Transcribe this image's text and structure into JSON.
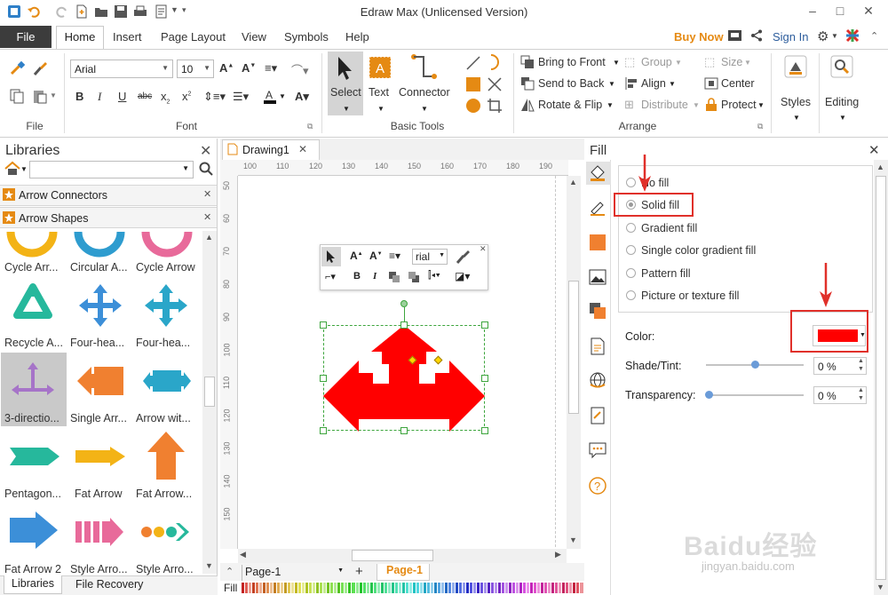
{
  "window": {
    "title": "Edraw Max (Unlicensed Version)",
    "minimize": "–",
    "maximize": "□",
    "close": "✕"
  },
  "menu": {
    "file": "File",
    "home": "Home",
    "insert": "Insert",
    "page_layout": "Page Layout",
    "view": "View",
    "symbols": "Symbols",
    "help": "Help",
    "buy_now": "Buy Now",
    "sign_in": "Sign In"
  },
  "ribbon": {
    "font_name": "Arial",
    "font_size": "10",
    "groups": {
      "file": "File",
      "font": "Font",
      "basic_tools": "Basic Tools",
      "arrange": "Arrange"
    },
    "tools": {
      "select": "Select",
      "text": "Text",
      "connector": "Connector"
    },
    "arrange": {
      "bring_front": "Bring to Front",
      "send_back": "Send to Back",
      "rotate_flip": "Rotate & Flip",
      "group": "Group",
      "align": "Align",
      "distribute": "Distribute",
      "size": "Size",
      "center": "Center",
      "protect": "Protect"
    },
    "styles": "Styles",
    "editing": "Editing"
  },
  "libraries": {
    "title": "Libraries",
    "search_placeholder": "",
    "sections": [
      "Arrow Connectors",
      "Arrow Shapes"
    ],
    "shapes": [
      [
        "Cycle Arr...",
        "Circular A...",
        "Cycle Arrow"
      ],
      [
        "Recycle A...",
        "Four-hea...",
        "Four-hea..."
      ],
      [
        "3-directio...",
        "Single Arr...",
        "Arrow wit..."
      ],
      [
        "Pentagon...",
        "Fat Arrow",
        "Fat Arrow..."
      ],
      [
        "Fat Arrow 2",
        "Style Arro...",
        "Style Arro..."
      ]
    ],
    "tabs": {
      "libraries": "Libraries",
      "file_recovery": "File Recovery"
    }
  },
  "canvas": {
    "doc_tab": "Drawing1",
    "ruler_h": [
      "100",
      "110",
      "120",
      "130",
      "140",
      "150",
      "160",
      "170",
      "180",
      "190"
    ],
    "ruler_v": [
      "50",
      "60",
      "70",
      "80",
      "90",
      "100",
      "110",
      "120",
      "130",
      "140",
      "150"
    ],
    "mini_toolbar_font": "rial",
    "page_select": "Page-1",
    "page_tab": "Page-1",
    "fill_label": "Fill",
    "shape_color": "#ff0000"
  },
  "fill_panel": {
    "title": "Fill",
    "options": [
      "No fill",
      "Solid fill",
      "Gradient fill",
      "Single color gradient fill",
      "Pattern fill",
      "Picture or texture fill"
    ],
    "selected": "Solid fill",
    "color_label": "Color:",
    "color_value": "#ff0000",
    "shade_label": "Shade/Tint:",
    "shade_value": "0 %",
    "transparency_label": "Transparency:",
    "transparency_value": "0 %"
  },
  "watermark": {
    "logo": "Baidu经验",
    "url": "jingyan.baidu.com"
  },
  "colors": {
    "accent": "#e58a13",
    "annotation": "#e0302a",
    "selection": "#2ea02e",
    "file_bg": "#3c3c3c"
  }
}
